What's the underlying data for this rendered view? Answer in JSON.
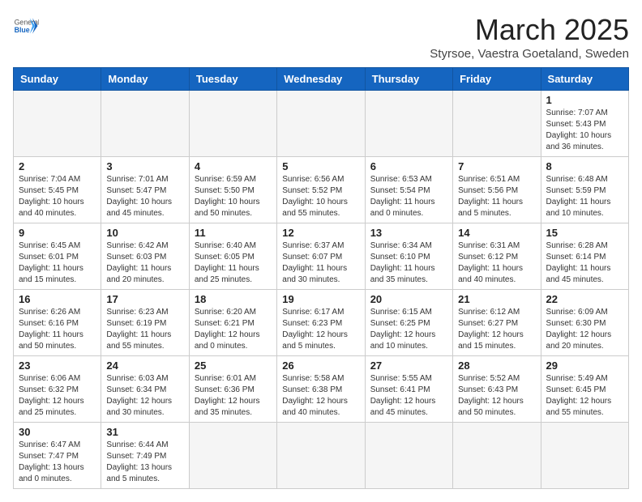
{
  "header": {
    "logo_general": "General",
    "logo_blue": "Blue",
    "month_title": "March 2025",
    "location": "Styrsoe, Vaestra Goetaland, Sweden"
  },
  "weekdays": [
    "Sunday",
    "Monday",
    "Tuesday",
    "Wednesday",
    "Thursday",
    "Friday",
    "Saturday"
  ],
  "days": [
    {
      "date": "",
      "info": ""
    },
    {
      "date": "",
      "info": ""
    },
    {
      "date": "",
      "info": ""
    },
    {
      "date": "",
      "info": ""
    },
    {
      "date": "",
      "info": ""
    },
    {
      "date": "",
      "info": ""
    },
    {
      "date": "1",
      "info": "Sunrise: 7:07 AM\nSunset: 5:43 PM\nDaylight: 10 hours and 36 minutes."
    },
    {
      "date": "2",
      "info": "Sunrise: 7:04 AM\nSunset: 5:45 PM\nDaylight: 10 hours and 40 minutes."
    },
    {
      "date": "3",
      "info": "Sunrise: 7:01 AM\nSunset: 5:47 PM\nDaylight: 10 hours and 45 minutes."
    },
    {
      "date": "4",
      "info": "Sunrise: 6:59 AM\nSunset: 5:50 PM\nDaylight: 10 hours and 50 minutes."
    },
    {
      "date": "5",
      "info": "Sunrise: 6:56 AM\nSunset: 5:52 PM\nDaylight: 10 hours and 55 minutes."
    },
    {
      "date": "6",
      "info": "Sunrise: 6:53 AM\nSunset: 5:54 PM\nDaylight: 11 hours and 0 minutes."
    },
    {
      "date": "7",
      "info": "Sunrise: 6:51 AM\nSunset: 5:56 PM\nDaylight: 11 hours and 5 minutes."
    },
    {
      "date": "8",
      "info": "Sunrise: 6:48 AM\nSunset: 5:59 PM\nDaylight: 11 hours and 10 minutes."
    },
    {
      "date": "9",
      "info": "Sunrise: 6:45 AM\nSunset: 6:01 PM\nDaylight: 11 hours and 15 minutes."
    },
    {
      "date": "10",
      "info": "Sunrise: 6:42 AM\nSunset: 6:03 PM\nDaylight: 11 hours and 20 minutes."
    },
    {
      "date": "11",
      "info": "Sunrise: 6:40 AM\nSunset: 6:05 PM\nDaylight: 11 hours and 25 minutes."
    },
    {
      "date": "12",
      "info": "Sunrise: 6:37 AM\nSunset: 6:07 PM\nDaylight: 11 hours and 30 minutes."
    },
    {
      "date": "13",
      "info": "Sunrise: 6:34 AM\nSunset: 6:10 PM\nDaylight: 11 hours and 35 minutes."
    },
    {
      "date": "14",
      "info": "Sunrise: 6:31 AM\nSunset: 6:12 PM\nDaylight: 11 hours and 40 minutes."
    },
    {
      "date": "15",
      "info": "Sunrise: 6:28 AM\nSunset: 6:14 PM\nDaylight: 11 hours and 45 minutes."
    },
    {
      "date": "16",
      "info": "Sunrise: 6:26 AM\nSunset: 6:16 PM\nDaylight: 11 hours and 50 minutes."
    },
    {
      "date": "17",
      "info": "Sunrise: 6:23 AM\nSunset: 6:19 PM\nDaylight: 11 hours and 55 minutes."
    },
    {
      "date": "18",
      "info": "Sunrise: 6:20 AM\nSunset: 6:21 PM\nDaylight: 12 hours and 0 minutes."
    },
    {
      "date": "19",
      "info": "Sunrise: 6:17 AM\nSunset: 6:23 PM\nDaylight: 12 hours and 5 minutes."
    },
    {
      "date": "20",
      "info": "Sunrise: 6:15 AM\nSunset: 6:25 PM\nDaylight: 12 hours and 10 minutes."
    },
    {
      "date": "21",
      "info": "Sunrise: 6:12 AM\nSunset: 6:27 PM\nDaylight: 12 hours and 15 minutes."
    },
    {
      "date": "22",
      "info": "Sunrise: 6:09 AM\nSunset: 6:30 PM\nDaylight: 12 hours and 20 minutes."
    },
    {
      "date": "23",
      "info": "Sunrise: 6:06 AM\nSunset: 6:32 PM\nDaylight: 12 hours and 25 minutes."
    },
    {
      "date": "24",
      "info": "Sunrise: 6:03 AM\nSunset: 6:34 PM\nDaylight: 12 hours and 30 minutes."
    },
    {
      "date": "25",
      "info": "Sunrise: 6:01 AM\nSunset: 6:36 PM\nDaylight: 12 hours and 35 minutes."
    },
    {
      "date": "26",
      "info": "Sunrise: 5:58 AM\nSunset: 6:38 PM\nDaylight: 12 hours and 40 minutes."
    },
    {
      "date": "27",
      "info": "Sunrise: 5:55 AM\nSunset: 6:41 PM\nDaylight: 12 hours and 45 minutes."
    },
    {
      "date": "28",
      "info": "Sunrise: 5:52 AM\nSunset: 6:43 PM\nDaylight: 12 hours and 50 minutes."
    },
    {
      "date": "29",
      "info": "Sunrise: 5:49 AM\nSunset: 6:45 PM\nDaylight: 12 hours and 55 minutes."
    },
    {
      "date": "30",
      "info": "Sunrise: 6:47 AM\nSunset: 7:47 PM\nDaylight: 13 hours and 0 minutes."
    },
    {
      "date": "31",
      "info": "Sunrise: 6:44 AM\nSunset: 7:49 PM\nDaylight: 13 hours and 5 minutes."
    },
    {
      "date": "",
      "info": ""
    },
    {
      "date": "",
      "info": ""
    },
    {
      "date": "",
      "info": ""
    },
    {
      "date": "",
      "info": ""
    },
    {
      "date": "",
      "info": ""
    }
  ]
}
